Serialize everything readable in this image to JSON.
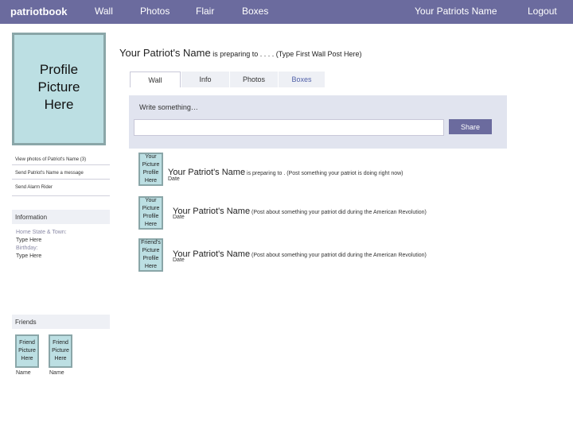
{
  "nav": {
    "brand": "patriotbook",
    "items": [
      "Wall",
      "Photos",
      "Flair",
      "Boxes"
    ],
    "user": "Your Patriots Name",
    "logout": "Logout"
  },
  "profile": {
    "picture_text": "Profile Picture Here",
    "headline_name": "Your Patriot's Name",
    "headline_rest": " is preparing to . . . . (Type First Wall Post Here)"
  },
  "tabs": [
    "Wall",
    "Info",
    "Photos",
    "Boxes"
  ],
  "composer": {
    "prompt": "Write something…",
    "share_label": "Share"
  },
  "sidebar": {
    "links": [
      "View photos of Patriot's Name (3)",
      "Send Patriot's Name a message",
      "Send Alarm Rider"
    ],
    "information_heading": "Information",
    "home_label": "Home State & Town:",
    "home_value": "Type Here",
    "birthday_label": "Birthday:",
    "birthday_value": "Type Here",
    "friends_heading": "Friends",
    "friends": [
      {
        "picture": "Friend Picture Here",
        "name": "Name"
      },
      {
        "picture": "Friend Picture Here",
        "name": "Name"
      }
    ]
  },
  "posts": [
    {
      "picture": "Your Picture Profile Here",
      "name": "Your Patriot's Name",
      "text": " is preparing to . (Post something your patriot is doing right now)",
      "date": "Date"
    },
    {
      "picture": "Your Picture Profile Here",
      "name": "Your Patriot's Name",
      "text": " (Post about something your patriot did during the American Revolution)",
      "date": "Date"
    },
    {
      "picture": "Friend's Picture Profile Here",
      "name": "Your Patriot's Name",
      "text": " (Post about something your patriot did during the American Revolution)",
      "date": "Date"
    }
  ],
  "colors": {
    "nav_bg": "#6b6b9e",
    "picture_bg": "#bcdfe3",
    "composer_bg": "#e1e4ef"
  }
}
